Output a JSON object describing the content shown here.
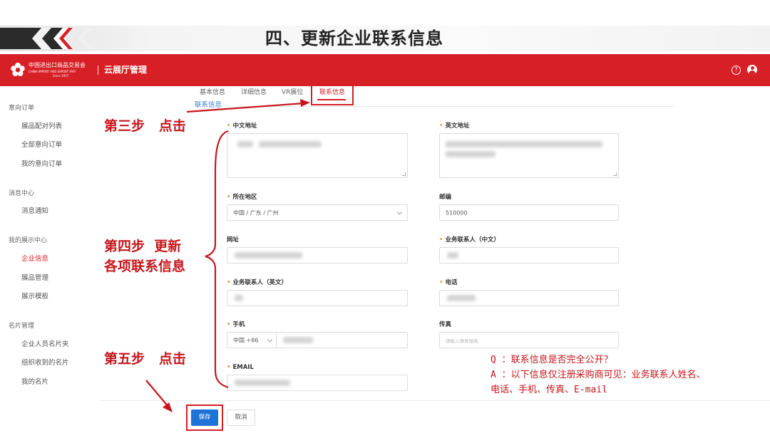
{
  "slide": {
    "title": "四、更新企业联系信息"
  },
  "header": {
    "brand_cn": "中国进出口商品交易会",
    "brand_en": "CHINA IMPORT AND EXPORT FAIR",
    "brand_since": "Since 1957",
    "app_name": "云展厅管理",
    "help_glyph": "?",
    "help_icon": "question-circle-icon",
    "user_icon": "user-avatar-icon",
    "color": "#d71f26"
  },
  "sidebar": {
    "groups": [
      {
        "label": "意向订单",
        "items": [
          {
            "label": "展品配对列表"
          },
          {
            "label": "全部意向订单"
          },
          {
            "label": "我的意向订单"
          }
        ]
      },
      {
        "label": "消息中心",
        "items": [
          {
            "label": "消息通知"
          }
        ]
      },
      {
        "label": "我的展示中心",
        "items": [
          {
            "label": "企业信息",
            "active": true
          },
          {
            "label": "展品管理"
          },
          {
            "label": "展示模板"
          }
        ]
      },
      {
        "label": "名片管理",
        "items": [
          {
            "label": "企业人员名片夹"
          },
          {
            "label": "组织收到的名片"
          },
          {
            "label": "我的名片"
          }
        ]
      }
    ]
  },
  "tabs": [
    {
      "label": "基本信息"
    },
    {
      "label": "详细信息"
    },
    {
      "label": "VR展位"
    },
    {
      "label": "联系信息",
      "active": true
    }
  ],
  "section_label": "联系信息",
  "form": {
    "cn_address": {
      "label": "中文地址"
    },
    "en_address": {
      "label": "英文地址"
    },
    "region": {
      "label": "所在地区",
      "value": "中国 / 广东 / 广州"
    },
    "postcode": {
      "label": "邮编",
      "value": "510000"
    },
    "website": {
      "label": "网址"
    },
    "contact_cn": {
      "label": "业务联系人（中文）"
    },
    "contact_en": {
      "label": "业务联系人（英文）"
    },
    "phone": {
      "label": "电话"
    },
    "mobile": {
      "label": "手机",
      "country_code": "中国 +86"
    },
    "fax": {
      "label": "传真",
      "placeholder": "請輸入傳真號碼"
    },
    "email": {
      "label": "EMAIL"
    }
  },
  "buttons": {
    "save": "保存",
    "cancel": "取消",
    "save_color": "#1e73d8"
  },
  "annotations": {
    "step3": "第三步   点击",
    "step4_line1": "第四步  更新",
    "step4_line2": "各项联系信息",
    "step5": "第五步   点击",
    "color": "#c5151b"
  },
  "qa": {
    "q": "Q ：联系信息是否完全公开？",
    "a_line1": "A ：以下信息仅注册采购商可见：业务联系人姓名、",
    "a_line2": "电话、手机、传真、E-mail"
  }
}
